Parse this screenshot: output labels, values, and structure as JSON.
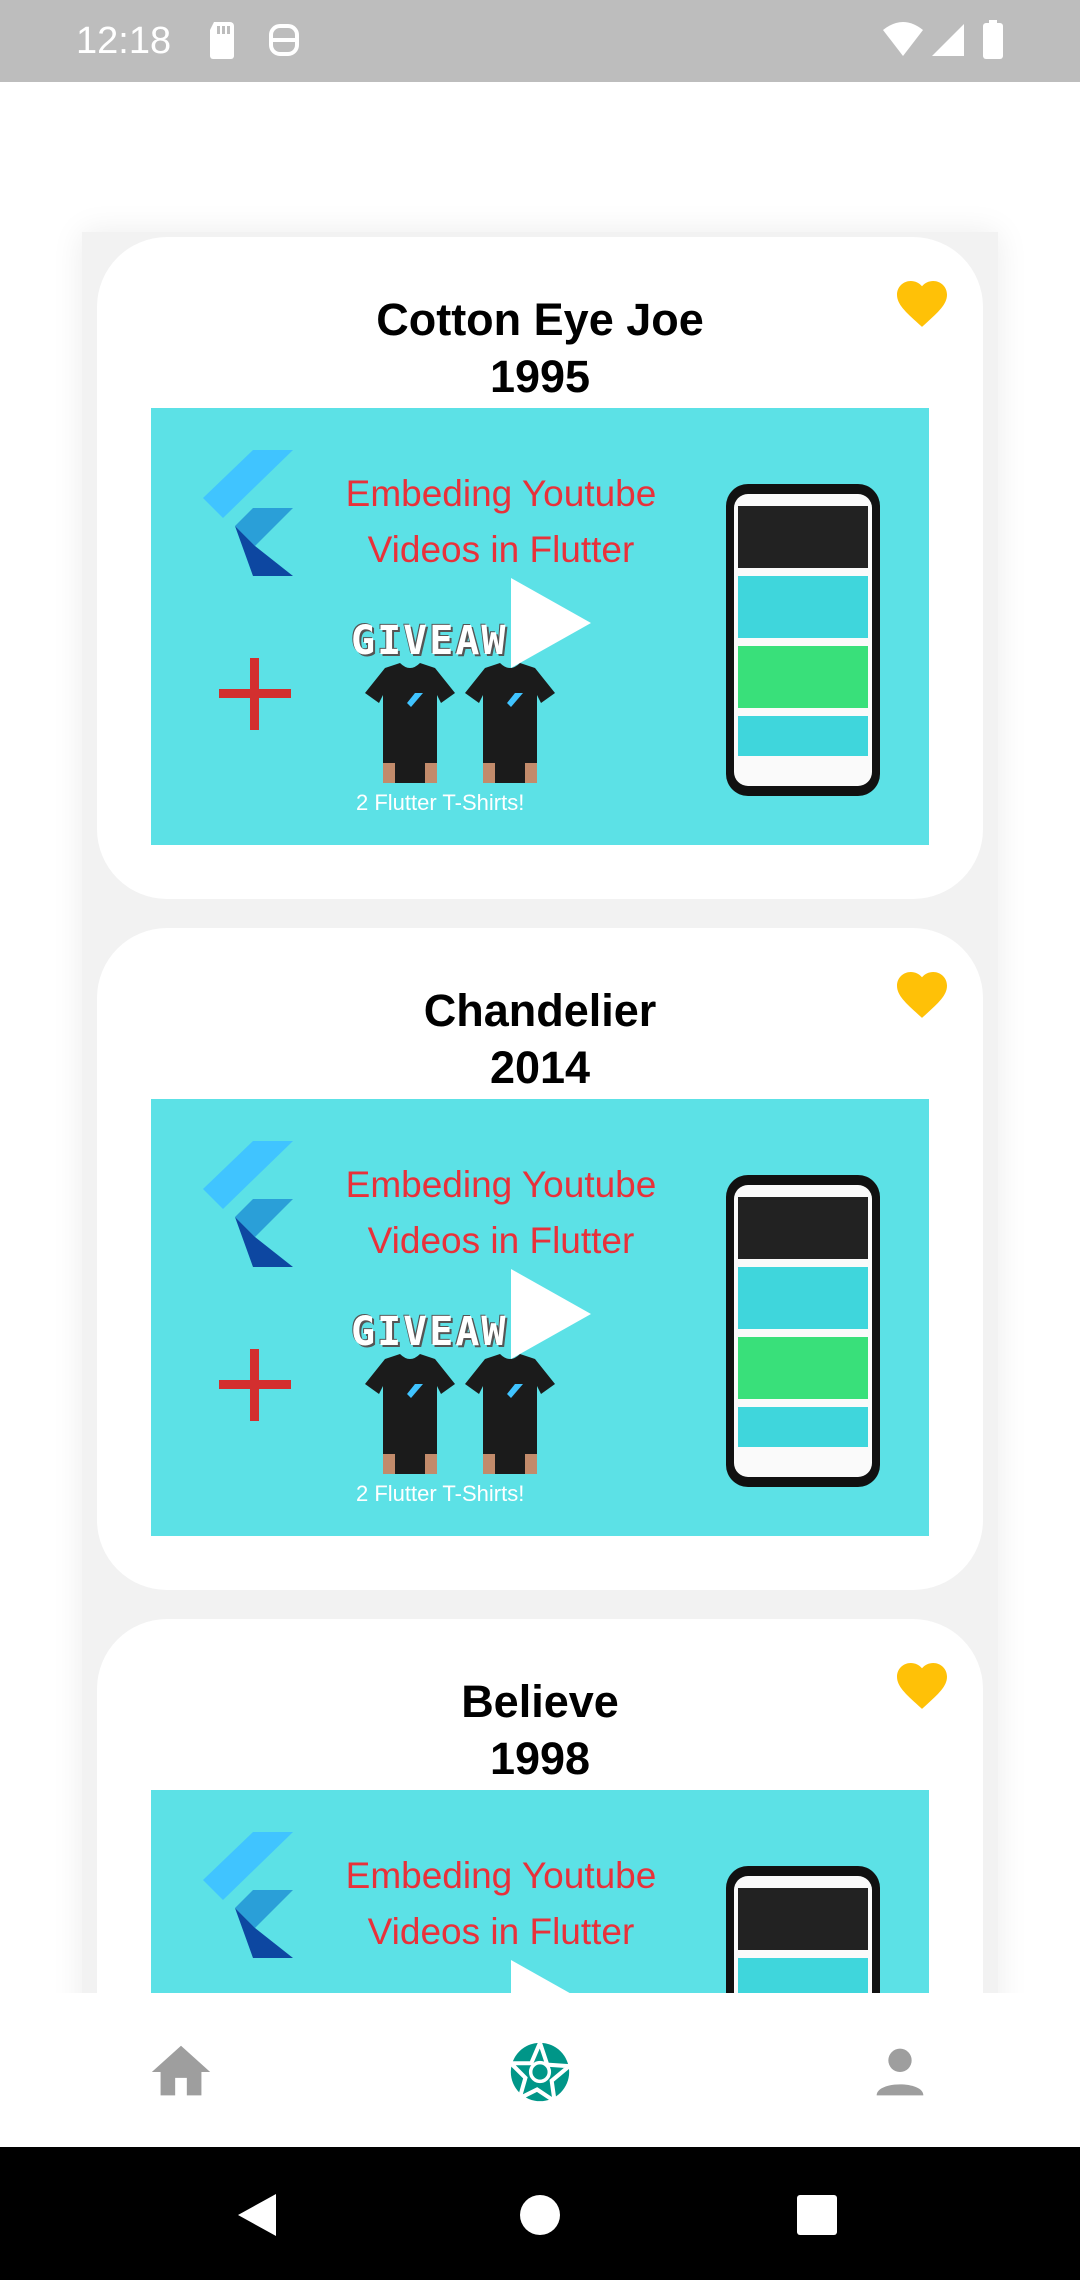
{
  "status_bar": {
    "time": "12:18",
    "icons": [
      "sd-card-icon",
      "assistant-icon",
      "wifi-icon",
      "cellular-icon",
      "battery-icon"
    ]
  },
  "cards": [
    {
      "title": "Cotton Eye Joe",
      "year": "1995",
      "favorite": true
    },
    {
      "title": "Chandelier",
      "year": "2014",
      "favorite": true
    },
    {
      "title": "Believe",
      "year": "1998",
      "favorite": true
    }
  ],
  "thumbnail": {
    "line1": "Embeding Youtube",
    "line2": "Videos in Flutter",
    "giveaway": "GIVEAW",
    "tshirts": "2 Flutter T-Shirts!",
    "background": "#5ce1e6",
    "text_color": "#e8313a"
  },
  "bottom_nav": {
    "items": [
      {
        "icon": "home-icon",
        "active": false
      },
      {
        "icon": "camera-aperture-icon",
        "active": true
      },
      {
        "icon": "person-icon",
        "active": false
      }
    ],
    "active_color": "#009688",
    "inactive_color": "#9e9e9e"
  },
  "colors": {
    "heart": "#ffc107"
  }
}
